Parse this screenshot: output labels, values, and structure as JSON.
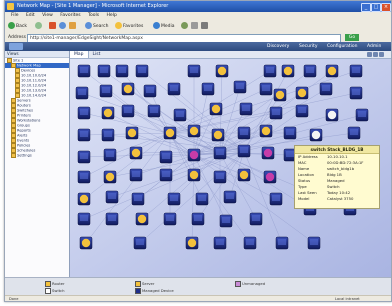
{
  "window": {
    "title": "Network Map - [Site 1 Manager] - Microsoft Internet Explorer",
    "controls": [
      "_",
      "□",
      "×"
    ]
  },
  "menubar": {
    "items": [
      "File",
      "Edit",
      "View",
      "Favorites",
      "Tools",
      "Help"
    ]
  },
  "toolbar": {
    "back": "Back",
    "search": "Search",
    "favorites": "Favorites",
    "media": "Media"
  },
  "address": {
    "label": "Address",
    "value": "http://site1-manager/EdgeSight/NetworkMap.aspx",
    "go": "Go"
  },
  "appbar": {
    "nav": [
      "Discovery",
      "Security",
      "Configuration",
      "Admin"
    ]
  },
  "sidebar": {
    "header": "Views",
    "items": [
      "Site 1",
      "Network Map",
      "Devices",
      "10.10.10.0/24",
      "10.10.11.0/24",
      "10.10.12.0/24",
      "10.10.13.0/24",
      "10.10.14.0/24",
      "Servers",
      "Routers",
      "Switches",
      "Printers",
      "Workstations",
      "Groups",
      "Reports",
      "Alerts",
      "Events",
      "Policies",
      "Schedules",
      "Settings"
    ],
    "selected": 1
  },
  "canvas_tabs": [
    "Map",
    "List"
  ],
  "tooltip": {
    "title": "switch Stack_BLDG_1B",
    "rows": [
      {
        "k": "IP Address",
        "v": "10.10.10.1"
      },
      {
        "k": "MAC",
        "v": "00:0D:BD:72:3A:1F"
      },
      {
        "k": "Name",
        "v": "switch_bldg1b"
      },
      {
        "k": "Location",
        "v": "Bldg 1B"
      },
      {
        "k": "Status",
        "v": "Managed"
      },
      {
        "k": "Type",
        "v": "Switch"
      },
      {
        "k": "Last Seen",
        "v": "Today 10:42"
      },
      {
        "k": "Model",
        "v": "Catalyst 3750"
      }
    ]
  },
  "legend": [
    {
      "label": "Router",
      "color": "#f3c13c"
    },
    {
      "label": "Switch",
      "color": "#ffffff"
    },
    {
      "label": "Server",
      "color": "#f3c13c"
    },
    {
      "label": "Managed Device",
      "color": "#1f2f8a"
    },
    {
      "label": "Unmanaged",
      "color": "#c98bd6"
    }
  ],
  "statusline": "Done",
  "zone": "Local intranet",
  "colors": {
    "accent": "#3168c6",
    "node_blue": "#1f2f8a",
    "node_yellow": "#f3c13c",
    "node_magenta": "#c63ca8",
    "edge": "#8a96c8"
  }
}
